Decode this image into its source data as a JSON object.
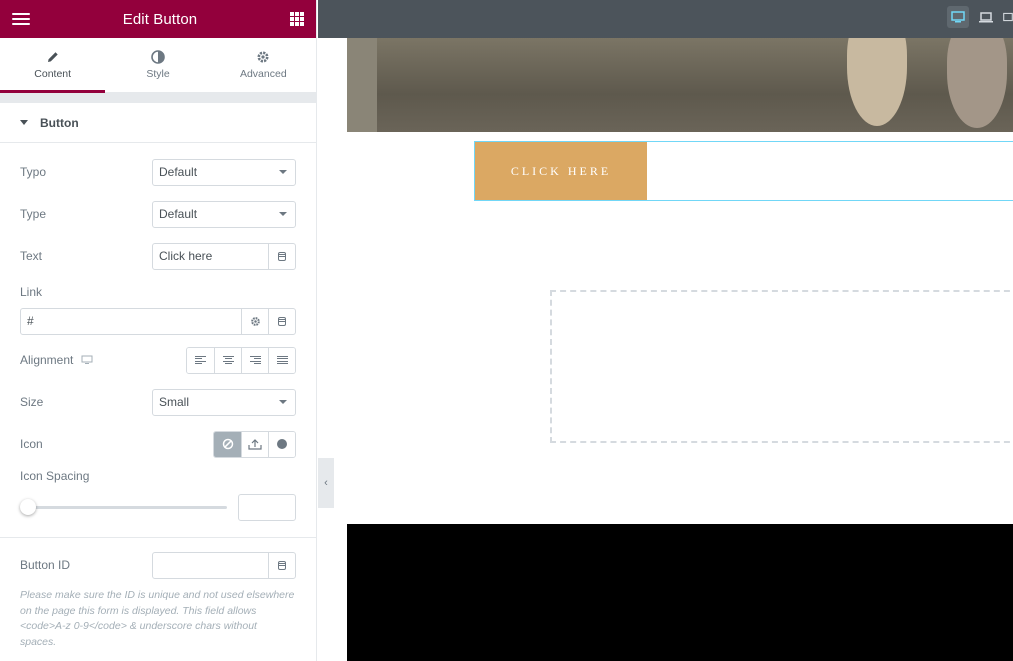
{
  "panel": {
    "title": "Edit Button",
    "tabs": [
      {
        "label": "Content",
        "icon": "pencil-icon"
      },
      {
        "label": "Style",
        "icon": "half-circle-icon"
      },
      {
        "label": "Advanced",
        "icon": "gear-icon"
      }
    ],
    "section_title": "Button",
    "controls": {
      "typo_label": "Typo",
      "typo_value": "Default",
      "type_label": "Type",
      "type_value": "Default",
      "text_label": "Text",
      "text_value": "Click here",
      "link_label": "Link",
      "link_value": "#",
      "alignment_label": "Alignment",
      "size_label": "Size",
      "size_value": "Small",
      "icon_label": "Icon",
      "icon_spacing_label": "Icon Spacing",
      "icon_spacing_level": 0,
      "button_id_label": "Button ID",
      "button_id_value": "",
      "button_id_help": "Please make sure the ID is unique and not used elsewhere on the page this form is displayed. This field allows <code>A-z 0-9</code> & underscore chars without spaces."
    },
    "accent_color": "#93003c"
  },
  "preview": {
    "cta_label": "CLICK HERE",
    "cta_color": "#dba863",
    "devices": [
      "desktop-icon",
      "laptop-icon",
      "tablet-icon"
    ]
  }
}
